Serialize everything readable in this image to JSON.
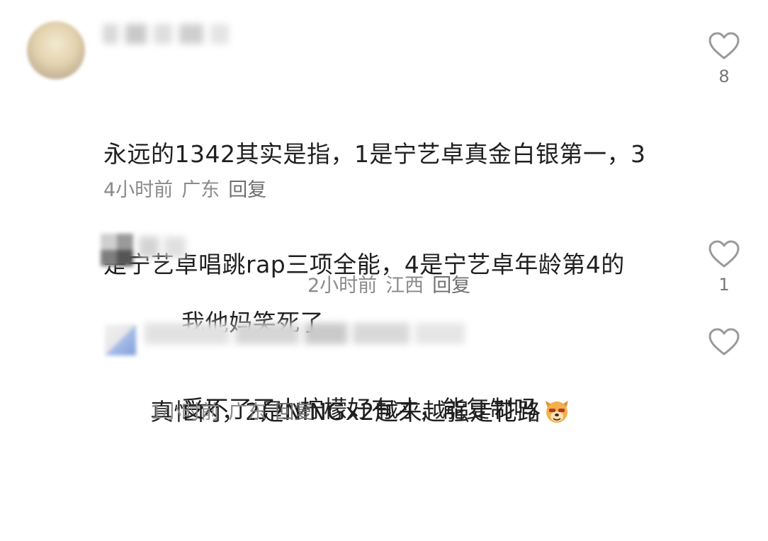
{
  "comments": [
    {
      "text_line1": "永远的1342其实是指，1是宁艺卓真金白银第一，3",
      "text_line2": "是宁艺卓唱跳rap三项全能，4是宁艺卓年龄第4的",
      "text_line3": "真忙内，2是NINGx2越来越强走花路",
      "emoji": "dog-face-emoji",
      "time": "4小时前",
      "location": "广东",
      "reply_label": "回复",
      "like_count": "8"
    },
    {
      "text": "我他妈笑死了",
      "time": "2小时前",
      "location": "江西",
      "reply_label": "回复",
      "like_count": "1"
    },
    {
      "text": "受不了了小柠檬好有才，能复制吗",
      "time": "1小时前",
      "location": "广东",
      "reply_label": "回复",
      "like_count": ""
    }
  ],
  "icons": {
    "like": "heart-outline-icon"
  },
  "colors": {
    "text": "#1f1f1f",
    "meta": "#8a8a8a",
    "heart_stroke": "#9a9a9a"
  }
}
